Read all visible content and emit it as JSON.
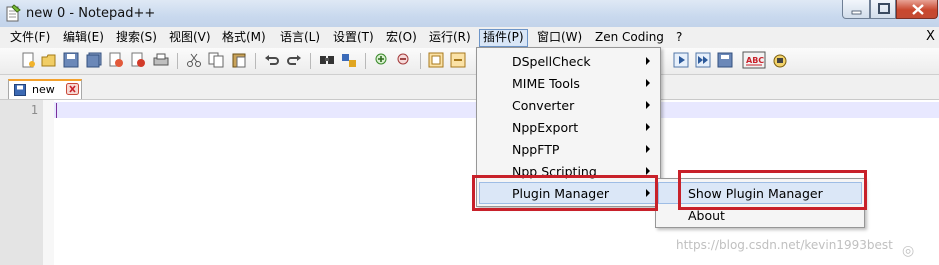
{
  "window": {
    "title": "new  0 - Notepad++"
  },
  "menubar": {
    "items": [
      {
        "label": "文件(F)"
      },
      {
        "label": "编辑(E)"
      },
      {
        "label": "搜索(S)"
      },
      {
        "label": "视图(V)"
      },
      {
        "label": "格式(M)"
      },
      {
        "label": "语言(L)"
      },
      {
        "label": "设置(T)"
      },
      {
        "label": "宏(O)"
      },
      {
        "label": "运行(R)"
      },
      {
        "label": "插件(P)"
      },
      {
        "label": "窗口(W)"
      },
      {
        "label": "Zen Coding"
      },
      {
        "label": "?"
      }
    ],
    "close_label": "X"
  },
  "tab": {
    "label": "new"
  },
  "editor": {
    "line_numbers": [
      "1"
    ]
  },
  "plugins_menu": {
    "items": [
      {
        "label": "DSpellCheck"
      },
      {
        "label": "MIME Tools"
      },
      {
        "label": "Converter"
      },
      {
        "label": "NppExport"
      },
      {
        "label": "NppFTP"
      },
      {
        "label": "Npp Scripting"
      },
      {
        "label": "Plugin Manager"
      }
    ]
  },
  "plugin_manager_submenu": {
    "items": [
      {
        "label": "Show Plugin Manager"
      },
      {
        "label": "About"
      }
    ]
  },
  "watermark": {
    "text": "https://blog.csdn.net/kevin1993best"
  },
  "colors": {
    "annotation": "#c8212a",
    "highlight": "#dbe7f7",
    "current_line": "#e8e8ff"
  }
}
